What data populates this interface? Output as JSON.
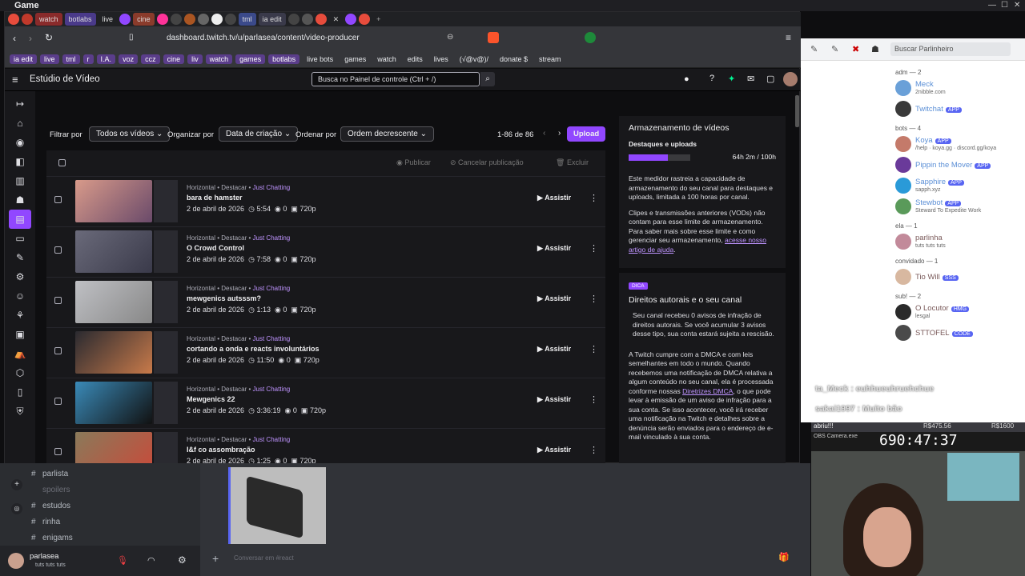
{
  "window": {
    "title": "Game"
  },
  "tabs": [
    "watch",
    "botlabs",
    "live",
    "cine",
    "tml",
    "ia edit"
  ],
  "url": "dashboard.twitch.tv/u/parlasea/content/video-producer",
  "bookmarks": [
    "ia edit",
    "live",
    "tml",
    "r",
    "I.A.",
    "voz",
    "ccz",
    "cine",
    "liv",
    "watch",
    "games",
    "botlabs"
  ],
  "bookmark_folders": [
    "live bots",
    "games",
    "watch",
    "edits",
    "lives",
    "(√@v@)/",
    "donate $",
    "stream"
  ],
  "header": {
    "title": "Estúdio de Vídeo",
    "search_placeholder": "Busca no Painel de controle (Ctrl + /)"
  },
  "filters": {
    "filter_label": "Filtrar por",
    "filter_value": "Todos os vídeos",
    "org_label": "Organizar por",
    "org_value": "Data de criação",
    "order_label": "Ordenar por",
    "order_value": "Ordem decrescente",
    "range": "1-86 de 86",
    "upload": "Upload"
  },
  "table_actions": {
    "publish": "Publicar",
    "unpublish": "Cancelar publicação",
    "delete": "Excluir"
  },
  "videos": [
    {
      "meta_a": "Horizontal • Destacar •",
      "category": "Just Chatting",
      "title": "bara de hamster",
      "date": "2 de abril de 2026",
      "duration": "5:54",
      "views": "0",
      "quality": "720p",
      "action": "Assistir"
    },
    {
      "meta_a": "Horizontal • Destacar •",
      "category": "Just Chatting",
      "title": "O Crowd Control",
      "date": "2 de abril de 2026",
      "duration": "7:58",
      "views": "0",
      "quality": "720p",
      "action": "Assistir"
    },
    {
      "meta_a": "Horizontal • Destacar •",
      "category": "Just Chatting",
      "title": "mewgenics autsssm?",
      "date": "2 de abril de 2026",
      "duration": "1:13",
      "views": "0",
      "quality": "720p",
      "action": "Assistir"
    },
    {
      "meta_a": "Horizontal • Destacar •",
      "category": "Just Chatting",
      "title": "cortando a onda e reacts involuntários",
      "date": "2 de abril de 2026",
      "duration": "11:50",
      "views": "0",
      "quality": "720p",
      "action": "Assistir"
    },
    {
      "meta_a": "Horizontal • Destacar •",
      "category": "Just Chatting",
      "title": "Mewgenics 22",
      "date": "2 de abril de 2026",
      "duration": "3:36:19",
      "views": "0",
      "quality": "720p",
      "action": "Assistir"
    },
    {
      "meta_a": "Horizontal • Destacar •",
      "category": "Just Chatting",
      "title": "I&f co assombração",
      "date": "2 de abril de 2026",
      "duration": "1:25",
      "views": "0",
      "quality": "720p",
      "action": "Assistir"
    }
  ],
  "storage": {
    "title": "Armazenamento de vídeos",
    "sub": "Destaques e uploads",
    "usage": "64h 2m / 100h",
    "usage_fraction": 0.64,
    "p1": "Este medidor rastreia a capacidade de armazenamento do seu canal para destaques e uploads, limitada a 100 horas por canal.",
    "p2": "Clipes e transmissões anteriores (VODs) não contam para esse limite de armazenamento. Para saber mais sobre esse limite e como gerenciar seu armazenamento,",
    "p2_link": "acesse nosso artigo de ajuda"
  },
  "dmca": {
    "tag": "DICA",
    "title": "Direitos autorais e o seu canal",
    "p1": "Seu canal recebeu 0 avisos de infração de direitos autorais. Se você acumular 3 avisos desse tipo, sua conta estará sujeita a rescisão.",
    "p2": "A Twitch cumpre com a DMCA e com leis semelhantes em todo o mundo. Quando recebemos uma notificação de DMCA relativa a algum conteúdo no seu canal, ela é processada conforme nossas",
    "p2_link": "Diretrizes DMCA",
    "p2b": ", o que pode levar à emissão de um aviso de infração para a sua conta. Se isso acontecer, você irá receber uma notificação na Twitch e detalhes sobre a denúncia serão enviados para o endereço de e-mail vinculado à sua conta."
  },
  "discord": {
    "channels": [
      "parlista",
      "spoilers",
      "estudos",
      "rinha",
      "enigams"
    ],
    "user": "parlasea",
    "status": "tuts tuts tuts",
    "input_placeholder": "Conversar em #react"
  },
  "chat": {
    "search": "Buscar Parlinheiro",
    "groups": [
      {
        "label": "adm — 2",
        "users": [
          {
            "name": "Meck",
            "sub": "2nibble.com"
          },
          {
            "name": "Twitchat",
            "sub": "",
            "badge": "APP"
          }
        ]
      },
      {
        "label": "bots — 4",
        "users": [
          {
            "name": "Koya",
            "sub": "/help · koya.gg · discord.gg/koya",
            "badge": "APP"
          },
          {
            "name": "Pippin the Mover",
            "sub": "",
            "badge": "APP"
          },
          {
            "name": "Sapphire",
            "sub": "sapph.xyz",
            "badge": "APP"
          },
          {
            "name": "Stewbot",
            "sub": "Steward To Expedite Work",
            "badge": "APP"
          }
        ]
      },
      {
        "label": "ela — 1",
        "users": [
          {
            "name": "parlinha",
            "sub": "tuts tuts tuts"
          }
        ]
      },
      {
        "label": "convidado — 1",
        "users": [
          {
            "name": "Tio Will",
            "sub": "",
            "badge": "SSS"
          }
        ]
      },
      {
        "label": "sub! — 2",
        "users": [
          {
            "name": "O Locutor",
            "sub": "lesgal",
            "badge": "HMG"
          },
          {
            "name": "STTOFEL",
            "sub": "",
            "badge": "CODE"
          }
        ]
      }
    ],
    "overlay1": "ta_Meck : euhhueuhruehchue",
    "overlay2": "sakai1997 : Muito bão"
  },
  "stream_overlay": {
    "label": "abriu!!!",
    "left_amount": "R$475.56",
    "right_amount": "R$1600",
    "timer": "690:47:37",
    "window": "OBS Camera.exe"
  }
}
